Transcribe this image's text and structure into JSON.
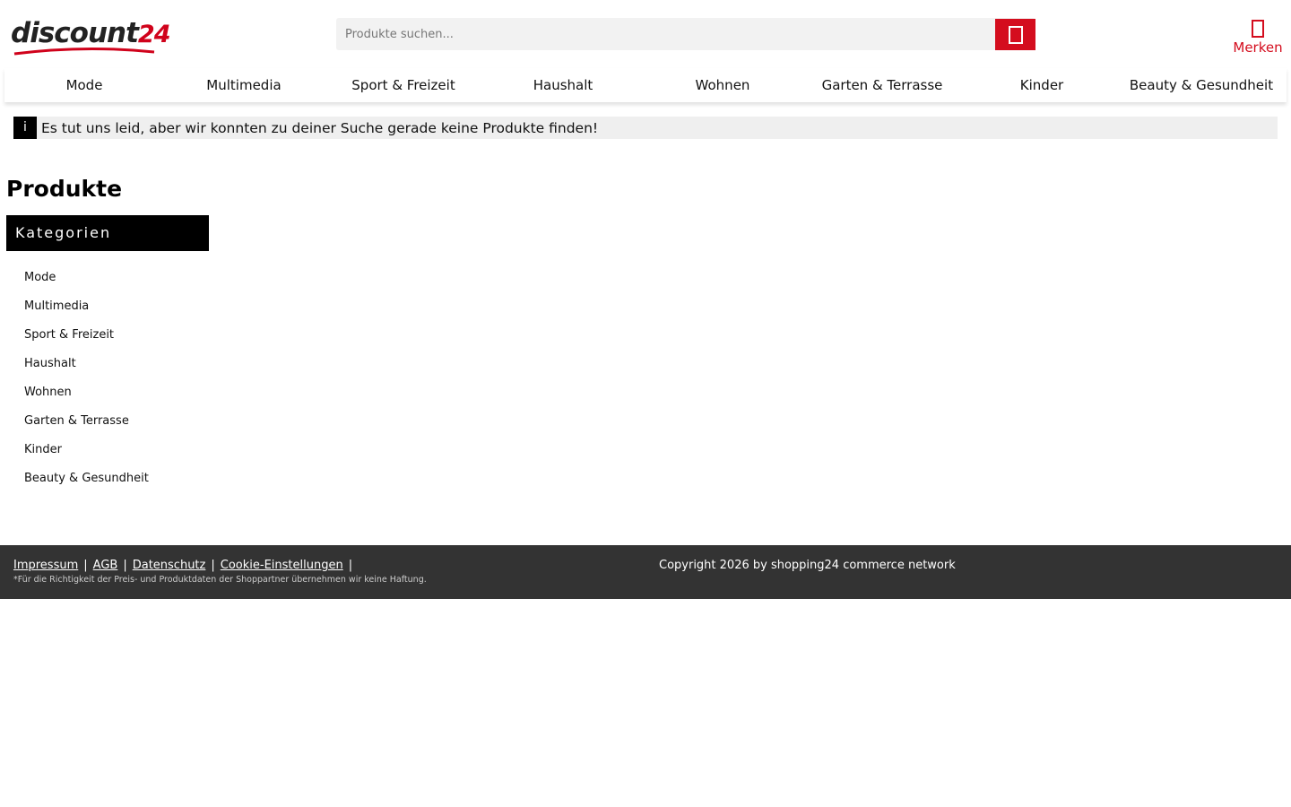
{
  "header": {
    "logo": {
      "text_main": "discount",
      "text_num": "24",
      "brand_color": "#d0021b"
    },
    "search": {
      "placeholder": "Produkte suchen...",
      "button_icon": "search-icon"
    },
    "merken": {
      "label": "Merken",
      "icon": "bookmark-icon",
      "color": "#d40d1e"
    }
  },
  "nav": {
    "items": [
      {
        "label": "Mode"
      },
      {
        "label": "Multimedia"
      },
      {
        "label": "Sport & Freizeit"
      },
      {
        "label": "Haushalt"
      },
      {
        "label": "Wohnen"
      },
      {
        "label": "Garten & Terrasse"
      },
      {
        "label": "Kinder"
      },
      {
        "label": "Beauty & Gesundheit"
      }
    ]
  },
  "notice": {
    "icon": "i",
    "text": "Es tut uns leid, aber wir konnten zu deiner Suche gerade keine Produkte finden!"
  },
  "main": {
    "title": "Produkte",
    "categories": {
      "header": "Kategorien",
      "items": [
        {
          "label": "Mode"
        },
        {
          "label": "Multimedia"
        },
        {
          "label": "Sport & Freizeit"
        },
        {
          "label": "Haushalt"
        },
        {
          "label": "Wohnen"
        },
        {
          "label": "Garten & Terrasse"
        },
        {
          "label": "Kinder"
        },
        {
          "label": "Beauty & Gesundheit"
        }
      ]
    }
  },
  "footer": {
    "links": [
      {
        "label": "Impressum"
      },
      {
        "label": "AGB"
      },
      {
        "label": "Datenschutz"
      },
      {
        "label": "Cookie-Einstellungen"
      }
    ],
    "separator": "|",
    "note": "*Für die Richtigkeit der Preis- und Produktdaten der Shoppartner übernehmen wir keine Haftung.",
    "copyright": "Copyright 2026 by shopping24 commerce network",
    "background": "#333333"
  }
}
